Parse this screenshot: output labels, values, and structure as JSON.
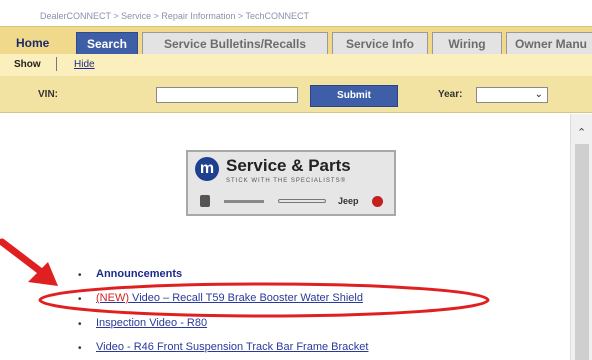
{
  "breadcrumb": "DealerCONNECT > Service > Repair Information > TechCONNECT",
  "tabs": [
    {
      "label": "Home"
    },
    {
      "label": "Search"
    },
    {
      "label": "Service Bulletins/Recalls"
    },
    {
      "label": "Service Info"
    },
    {
      "label": "Wiring"
    },
    {
      "label": "Owner Manu"
    }
  ],
  "subbar": {
    "show": "Show",
    "hide": "Hide"
  },
  "filter": {
    "vin_label": "VIN:",
    "vin_value": "",
    "submit": "Submit",
    "year_label": "Year:",
    "year_value": ""
  },
  "logo": {
    "title": "Service & Parts",
    "tagline": "STICK WITH THE SPECIALISTS®",
    "m": "m",
    "jeep": "Jeep"
  },
  "links": [
    {
      "text": "Announcements"
    },
    {
      "prefix": "(NEW)",
      "text": " Video – Recall T59 Brake Booster Water Shield"
    },
    {
      "text": "Inspection Video - R80"
    },
    {
      "text": "Video - R46 Front Suspension Track Bar Frame Bracket"
    }
  ],
  "colors": {
    "accent": "#3e5fa8",
    "tab_bar": "#f0d98a",
    "highlight": "#e02020"
  }
}
